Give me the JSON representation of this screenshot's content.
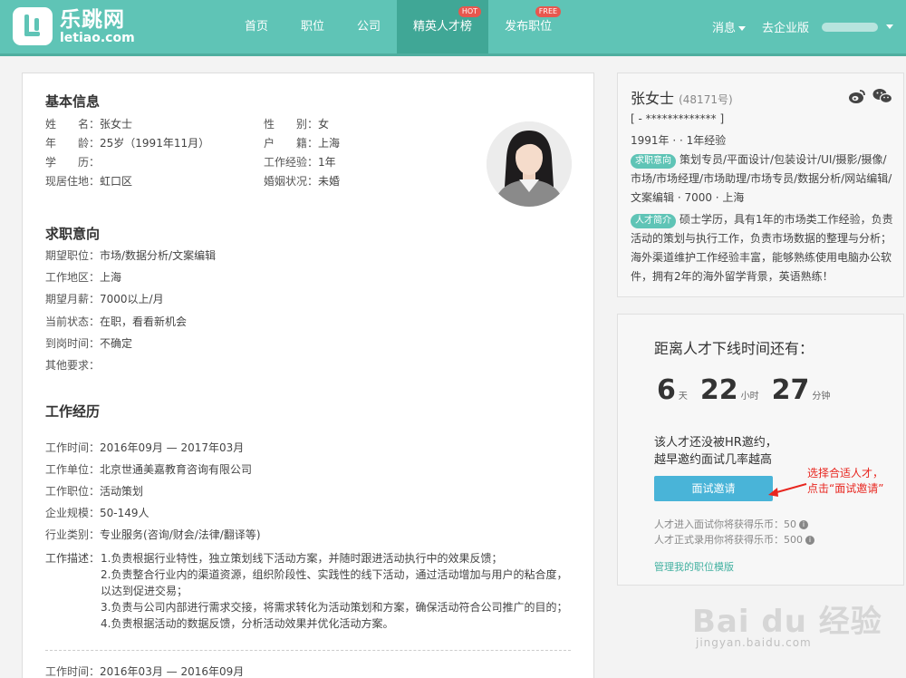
{
  "header": {
    "logo_cn": "乐跳网",
    "logo_en": "letiao.com",
    "nav": [
      {
        "label": "首页"
      },
      {
        "label": "职位"
      },
      {
        "label": "公司"
      },
      {
        "label": "精英人才榜",
        "badge": "HOT"
      },
      {
        "label": "发布职位",
        "badge": "FREE"
      }
    ],
    "messages": "消息",
    "enterprise": "去企业版"
  },
  "basic": {
    "title": "基本信息",
    "name_label": "姓　　名：",
    "name": "张女士",
    "age_label": "年　　龄：",
    "age": "25岁（1991年11月）",
    "edu_label": "学　　历：",
    "edu": "",
    "residence_label": "现居住地：",
    "residence": "虹口区",
    "gender_label": "性　　别：",
    "gender": "女",
    "hukou_label": "户　　籍：",
    "hukou": "上海",
    "exp_label": "工作经验：",
    "exp": "1年",
    "marital_label": "婚姻状况：",
    "marital": "未婚"
  },
  "intent": {
    "title": "求职意向",
    "position_label": "期望职位：",
    "position": "市场/数据分析/文案编辑",
    "area_label": "工作地区：",
    "area": "上海",
    "salary_label": "期望月薪：",
    "salary": "7000以上/月",
    "status_label": "当前状态：",
    "status": "在职，看看新机会",
    "arrival_label": "到岗时间：",
    "arrival": "不确定",
    "other_label": "其他要求：",
    "other": ""
  },
  "work": {
    "title": "工作经历",
    "time_label": "工作时间：",
    "time": "2016年09月 — 2017年03月",
    "company_label": "工作单位：",
    "company": "北京世通美嘉教育咨询有限公司",
    "position_label": "工作职位：",
    "position": "活动策划",
    "scale_label": "企业规模：",
    "scale": "50-149人",
    "industry_label": "行业类别：",
    "industry": "专业服务(咨询/财会/法律/翻译等)",
    "desc_label": "工作描述：",
    "desc_lines": [
      "1.负责根据行业特性，独立策划线下活动方案，并随时跟进活动执行中的效果反馈；",
      "2.负责整合行业内的渠道资源，组织阶段性、实践性的线下活动，通过活动增加与用户的粘合度，以达到促进交易；",
      "3.负责与公司内部进行需求交接，将需求转化为活动策划和方案，确保活动符合公司推广的目的；",
      "4.负责根据活动的数据反馈，分析活动效果并优化活动方案。"
    ],
    "time2_label": "工作时间：",
    "time2": "2016年03月 — 2016年09月"
  },
  "profile": {
    "name": "张女士",
    "id": "(48171号)",
    "phone": "[ - ************* ]",
    "summary": "1991年 · · 1年经验",
    "intent_tag": "求职意向",
    "intent_text": "策划专员/平面设计/包装设计/UI/摄影/摄像/市场/市场经理/市场助理/市场专员/数据分析/网站编辑/文案编辑 · 7000 · 上海",
    "intro_tag": "人才简介",
    "intro_text": "硕士学历，具有1年的市场类工作经验，负责活动的策划与执行工作，负责市场数据的整理与分析；海外渠道维护工作经验丰富，能够熟练使用电脑办公软件，拥有2年的海外留学背景，英语熟练！"
  },
  "countdown": {
    "title": "距离人才下线时间还有：",
    "days": "6",
    "days_unit": "天",
    "hours": "22",
    "hours_unit": "小时",
    "minutes": "27",
    "minutes_unit": "分钟",
    "line1": "该人才还没被HR邀约，",
    "line2": "越早邀约面试几率越高",
    "invite_button": "面试邀请",
    "coin1": "人才进入面试你将获得乐币：50",
    "coin2": "人才正式录用你将获得乐币：500",
    "manage_link": "管理我的职位模版"
  },
  "annotation": {
    "line1": "选择合适人才，",
    "line2": "点击“面试邀请”"
  },
  "watermark": {
    "main": "Bai du 经验",
    "sub": "jingyan.baidu.com"
  },
  "colors": {
    "header": "#5fc4b6",
    "nav_active": "#40a796",
    "button": "#49b4d8",
    "annotation": "#e8261f"
  }
}
